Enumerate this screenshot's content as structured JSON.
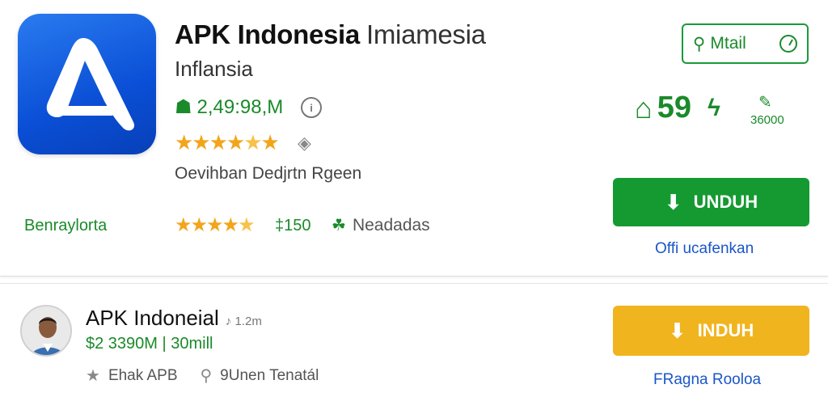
{
  "app": {
    "title": "APK Indonesia",
    "title_suffix": "Imiamesia",
    "subtitle": "Inflansia",
    "downloads": "2,49:98,M",
    "rating_stars": 4.5,
    "developer": "Oevihban Dedjrtn Rgeen",
    "category": "Benraylorta",
    "price": "‡150",
    "requirement": "Neadadas"
  },
  "actions": {
    "detail_button": "Mtail",
    "stat_value": "59",
    "stat_small": "36000",
    "download_button": "UNDUH",
    "link_text": "Offi ucafenkan"
  },
  "second_app": {
    "title": "APK Indoneial",
    "meta": "1.2m",
    "size_line": "$2 3390M | 30mill",
    "tag1": "Ehak APB",
    "tag2": "9Unen Tenatál",
    "download_button": "INDUH",
    "link_text": "FRagna Rooloa"
  },
  "colors": {
    "primary_green": "#159a32",
    "accent_yellow": "#f0b41e",
    "link_blue": "#1a56c8",
    "icon_blue": "#0a4fd6"
  },
  "icons": [
    "app-logo-icon",
    "downloads-icon",
    "info-icon",
    "rating-icon",
    "needs-icon",
    "search-icon",
    "clock-icon",
    "home-icon",
    "bolt-icon",
    "chat-icon",
    "download-arrow-icon",
    "star-icon",
    "search-small-icon"
  ]
}
